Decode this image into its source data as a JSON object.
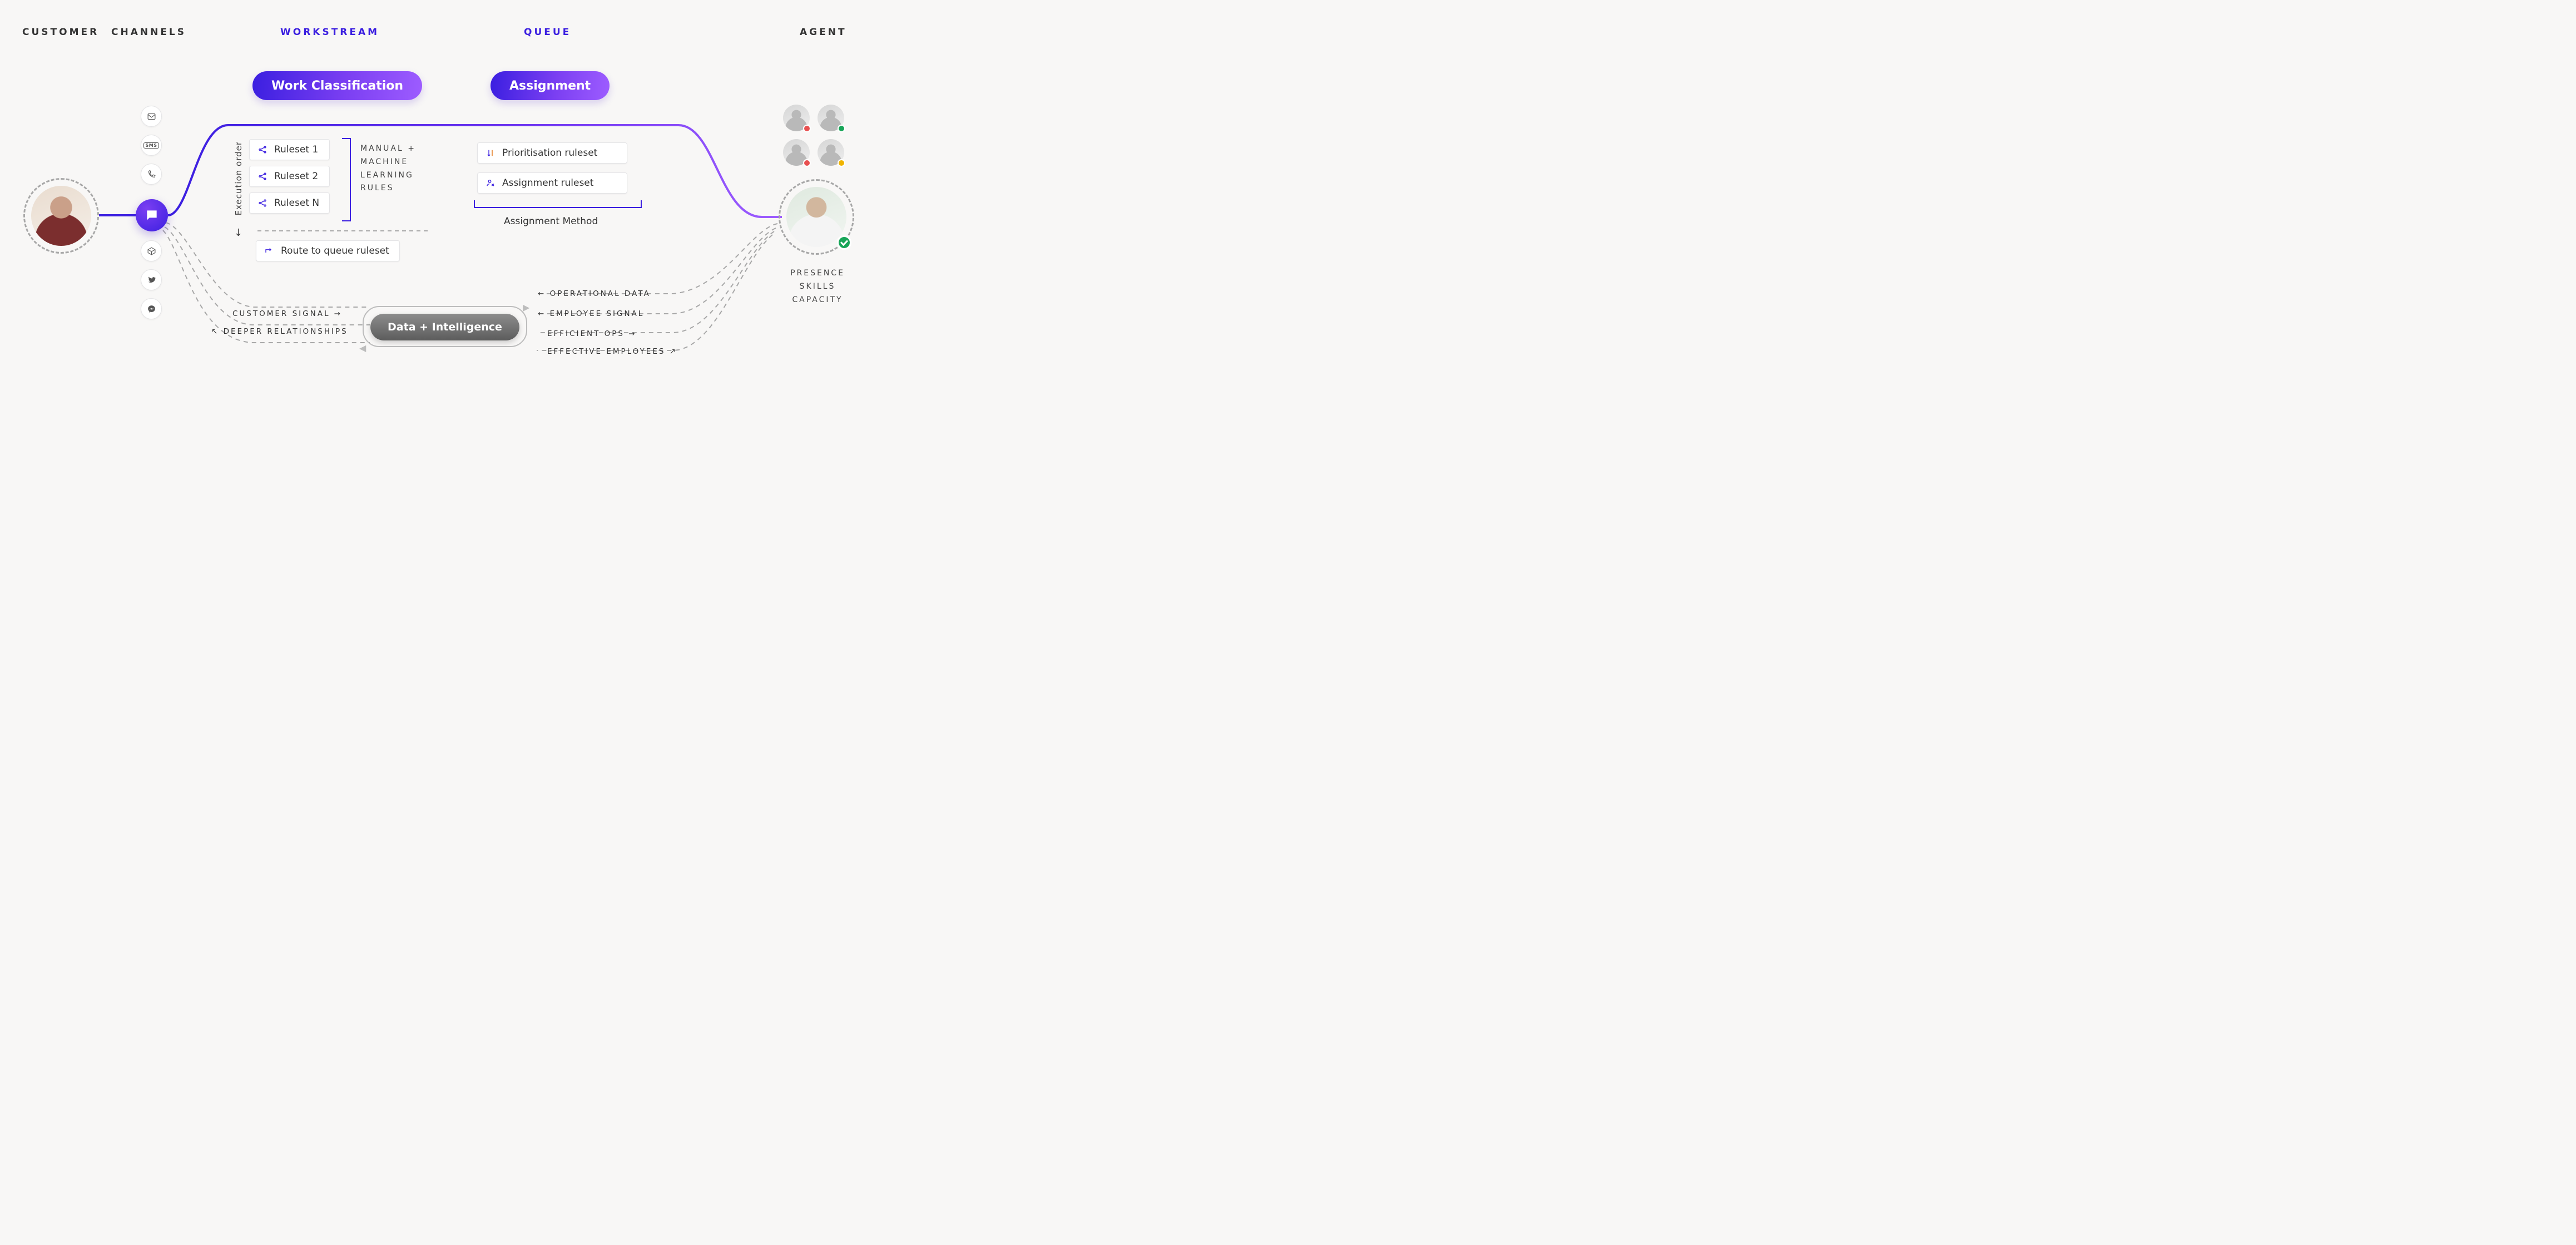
{
  "columns": {
    "customer": "CUSTOMER",
    "channels": "CHANNELS",
    "workstream": "WORKSTREAM",
    "queue": "QUEUE",
    "agent": "AGENT"
  },
  "pills": {
    "work_classification": "Work Classification",
    "assignment": "Assignment"
  },
  "workstream": {
    "execution_order_label": "Execution order",
    "rulesets": [
      "Ruleset 1",
      "Ruleset 2",
      "Ruleset N"
    ],
    "rules_type_lines": [
      "MANUAL +",
      "MACHINE",
      "LEARNING",
      "RULES"
    ],
    "route_card": "Route to queue ruleset"
  },
  "queue": {
    "prioritisation": "Prioritisation ruleset",
    "assignment_ruleset": "Assignment ruleset",
    "method_label": "Assignment Method"
  },
  "data_intel": {
    "capsule": "Data + Intelligence",
    "left": {
      "in": "CUSTOMER SIGNAL",
      "out": "DEEPER RELATIONSHIPS"
    },
    "right": {
      "in1": "OPERATIONAL DATA",
      "in2": "EMPLOYEE SIGNAL",
      "out1": "EFFICIENT OPS",
      "out2": "EFFECTIVE EMPLOYEES"
    }
  },
  "agent_attrs": [
    "PRESENCE",
    "SKILLS",
    "CAPACITY"
  ],
  "channels": {
    "items": [
      "email",
      "sms",
      "phone",
      "package",
      "twitter",
      "messenger"
    ]
  },
  "small_agents_status": [
    "red",
    "green",
    "red",
    "yellow"
  ]
}
